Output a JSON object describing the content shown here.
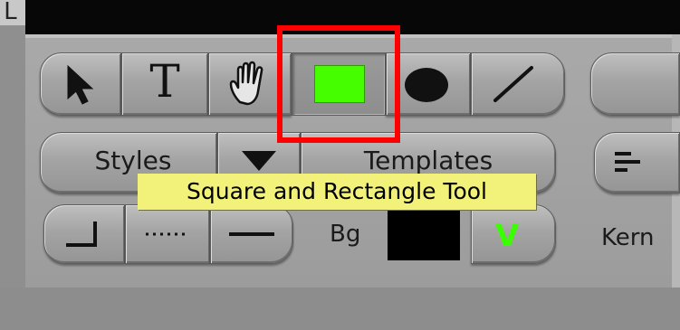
{
  "window": {
    "corner_glyph": "L"
  },
  "toolbar": {
    "tools": [
      {
        "name": "arrow",
        "icon": "arrow-cursor-icon"
      },
      {
        "name": "text",
        "label": "T",
        "icon": "text-icon"
      },
      {
        "name": "hand",
        "icon": "hand-icon"
      },
      {
        "name": "rectangle",
        "icon": "rectangle-icon",
        "selected": true,
        "color": "#45ff00"
      },
      {
        "name": "ellipse",
        "icon": "ellipse-icon"
      },
      {
        "name": "line",
        "icon": "line-icon"
      }
    ],
    "styles_label": "Styles",
    "templates_label": "Templates",
    "dropdown_icon": "triangle-down-icon",
    "bg_label": "Bg",
    "bg_color": "#000000",
    "kern_label": "Kern",
    "check_glyph": "V",
    "check_color": "#3aff00",
    "align_icon": "align-left-icon"
  },
  "tooltip": {
    "text": "Square and Rectangle Tool"
  },
  "highlight_color": "#ff0000"
}
